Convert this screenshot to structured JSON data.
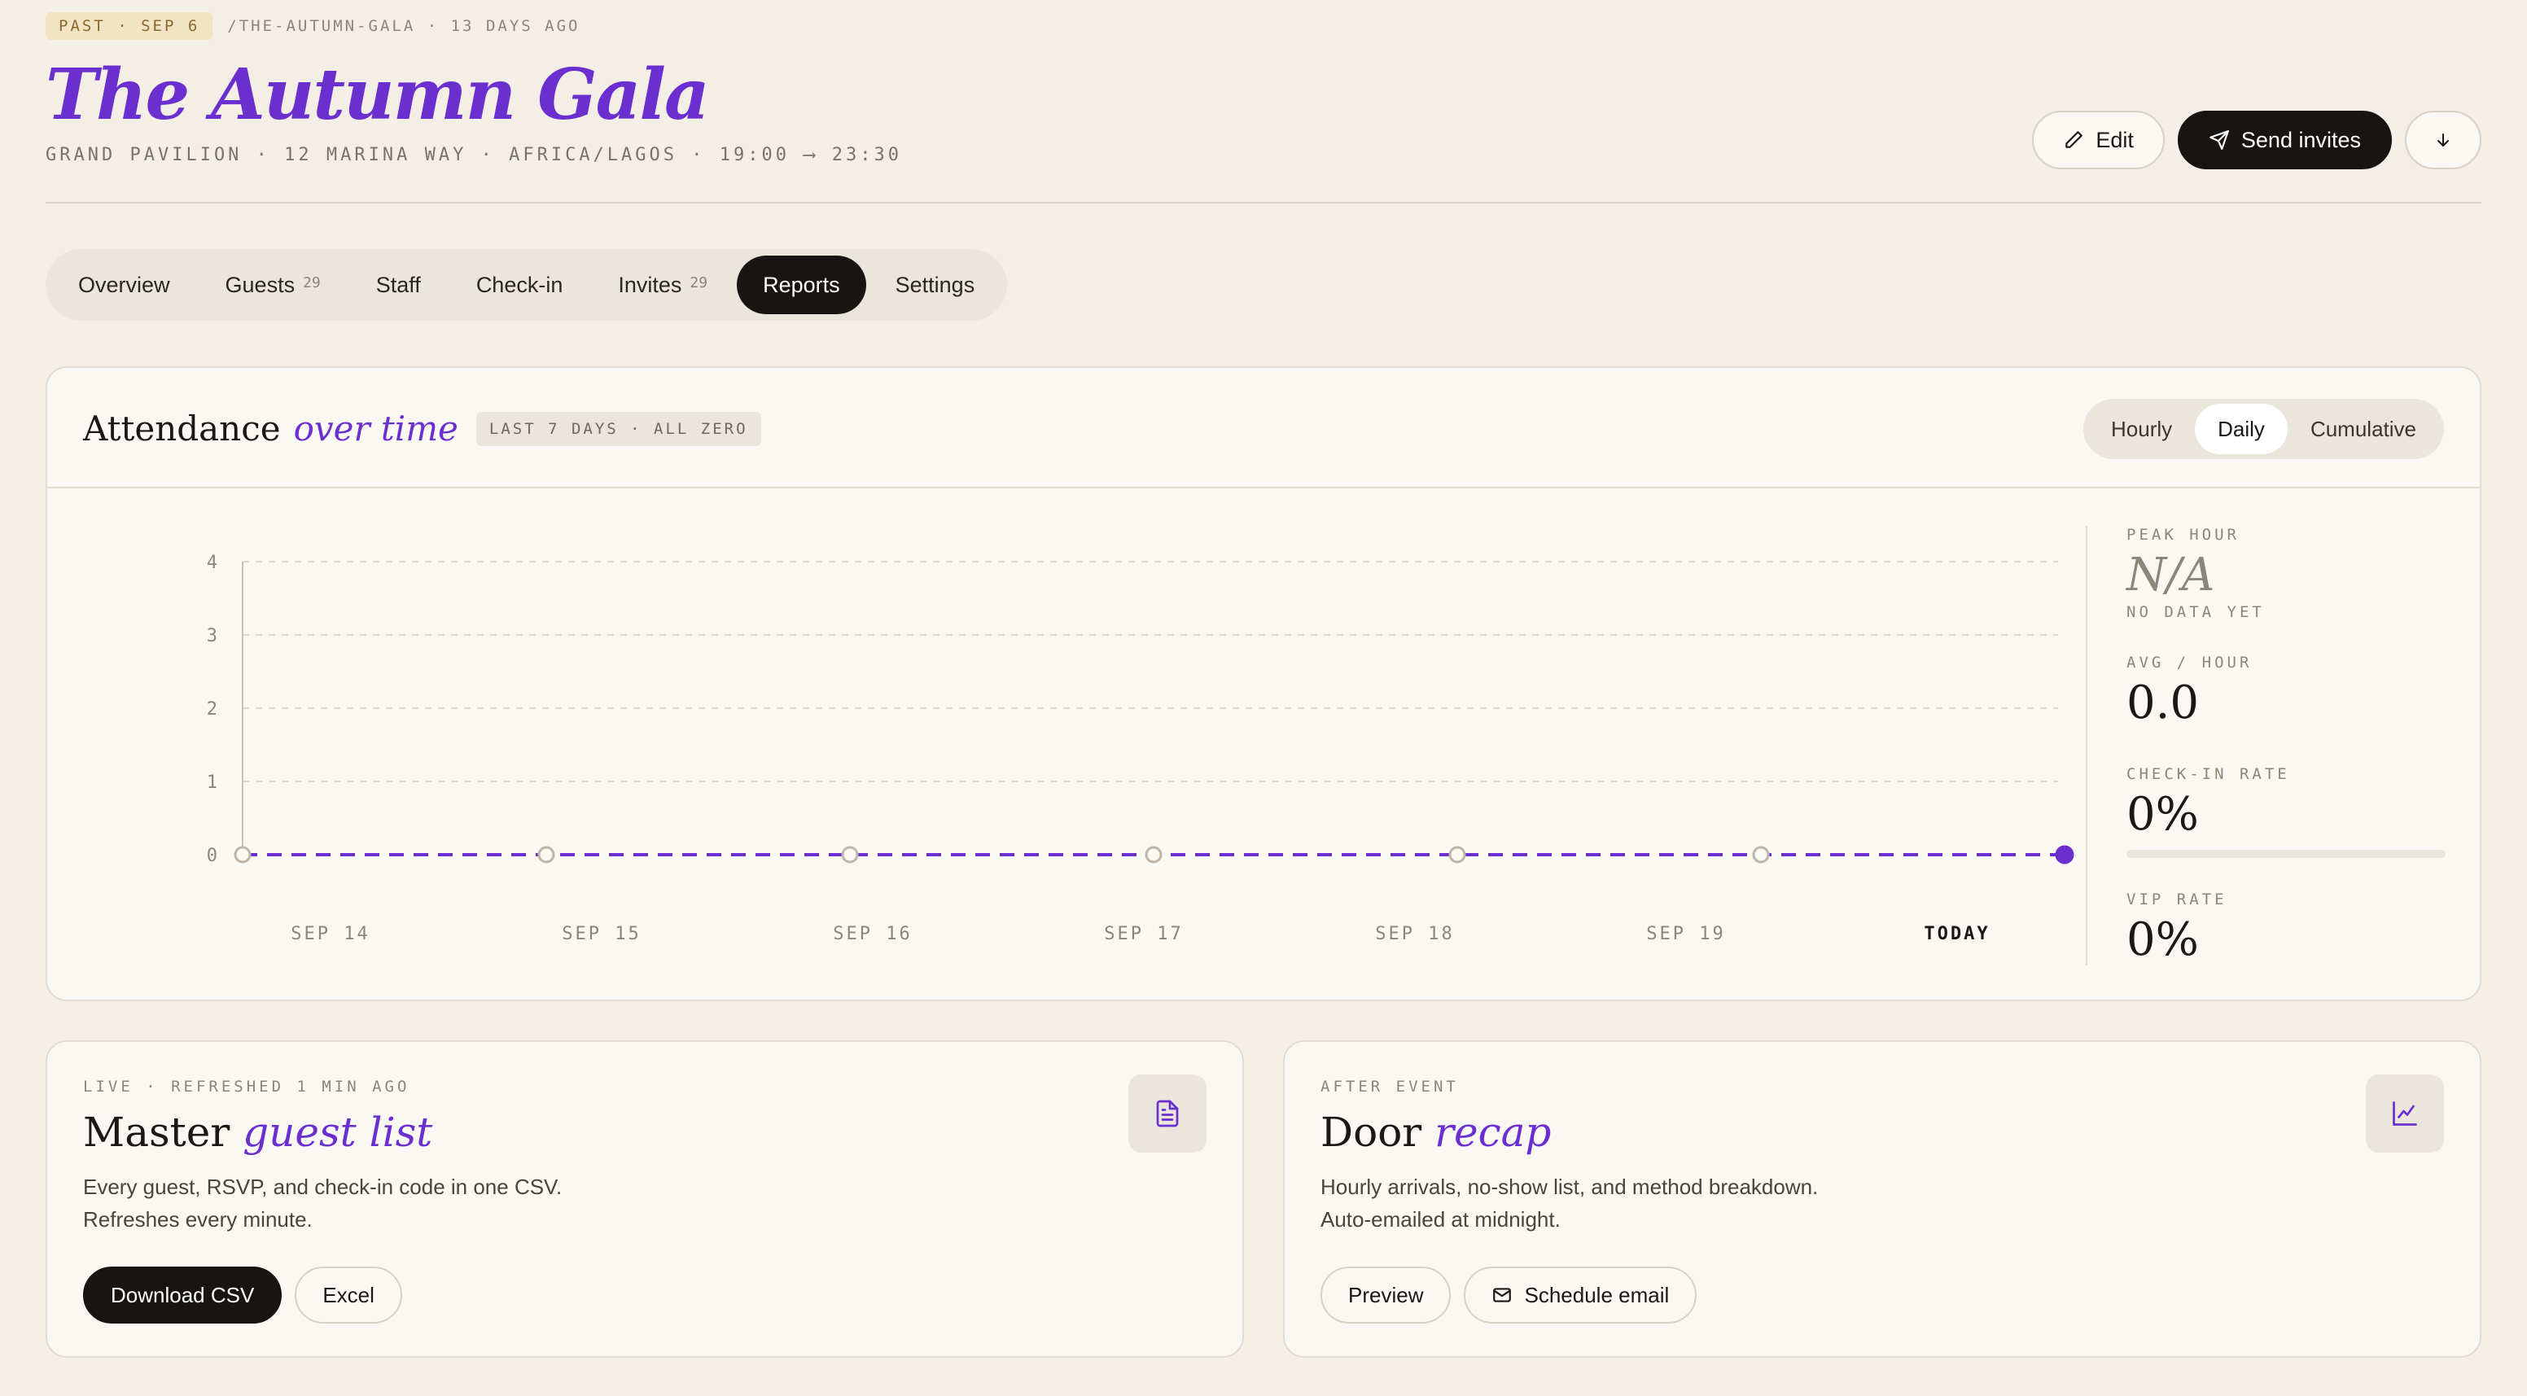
{
  "header": {
    "badge": "PAST · SEP 6",
    "slug": "/THE-AUTUMN-GALA · 13 DAYS AGO",
    "title": "The Autumn Gala",
    "venue": "GRAND PAVILION · 12 MARINA WAY · AFRICA/LAGOS · 19:00 ⟶ 23:30",
    "edit_label": "Edit",
    "send_label": "Send invites"
  },
  "tabs": [
    {
      "label": "Overview",
      "count": ""
    },
    {
      "label": "Guests",
      "count": "29"
    },
    {
      "label": "Staff",
      "count": ""
    },
    {
      "label": "Check-in",
      "count": ""
    },
    {
      "label": "Invites",
      "count": "29"
    },
    {
      "label": "Reports",
      "count": "",
      "active": true
    },
    {
      "label": "Settings",
      "count": ""
    }
  ],
  "attendance": {
    "title_main": "Attendance",
    "title_italic": "over time",
    "badge": "LAST 7 DAYS · ALL ZERO",
    "segments": [
      "Hourly",
      "Daily",
      "Cumulative"
    ],
    "active_segment": "Daily"
  },
  "chart_data": {
    "type": "line",
    "categories": [
      "SEP 14",
      "SEP 15",
      "SEP 16",
      "SEP 17",
      "SEP 18",
      "SEP 19",
      "TODAY"
    ],
    "values": [
      0,
      0,
      0,
      0,
      0,
      0,
      0
    ],
    "ylim": [
      0,
      4
    ],
    "yticks": [
      0,
      1,
      2,
      3,
      4
    ],
    "grid": true,
    "line_style": "dashed",
    "color": "#6b2fd0"
  },
  "stats": {
    "peak_label": "PEAK HOUR",
    "peak_value": "N/A",
    "peak_sub": "NO DATA YET",
    "avg_label": "AVG / HOUR",
    "avg_value": "0.0",
    "checkin_label": "CHECK-IN RATE",
    "checkin_value": "0%",
    "checkin_fraction": 0,
    "vip_label": "VIP RATE",
    "vip_value": "0%"
  },
  "guest_list": {
    "label": "LIVE · REFRESHED 1 MIN AGO",
    "title_main": "Master",
    "title_italic": "guest list",
    "description": "Every guest, RSVP, and check-in code in one CSV. Refreshes every minute.",
    "primary_label": "Download CSV",
    "secondary_label": "Excel",
    "icon": "document-icon"
  },
  "recap": {
    "label": "AFTER EVENT",
    "title_main": "Door",
    "title_italic": "recap",
    "description": "Hourly arrivals, no-show list, and method breakdown. Auto-emailed at midnight.",
    "primary_label": "Preview",
    "secondary_label": "Schedule email",
    "icon": "line-chart-icon"
  },
  "colors": {
    "accent": "#6b2fd0",
    "background": "#f3efe7",
    "card": "#faf8f3",
    "dark": "#171411"
  }
}
